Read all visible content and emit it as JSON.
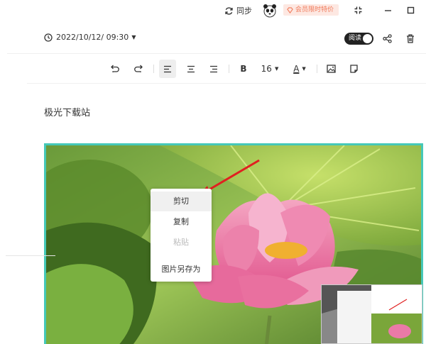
{
  "titlebar": {
    "sync_label": "同步",
    "vip_label": "会员限时特价"
  },
  "note": {
    "date": "2022/10/12/ 09:30",
    "read_toggle_label": "阅读",
    "title": "极光下载站"
  },
  "toolbar": {
    "font_size": "16",
    "bold_label": "B",
    "color_label": "A"
  },
  "context_menu": {
    "items": [
      "剪切",
      "复制",
      "粘贴",
      "图片另存为"
    ]
  },
  "colors": {
    "image_border": "#45c8b8",
    "arrow": "#e02020",
    "vip_text": "#f07a5a",
    "vip_bg": "#fde8e2"
  }
}
